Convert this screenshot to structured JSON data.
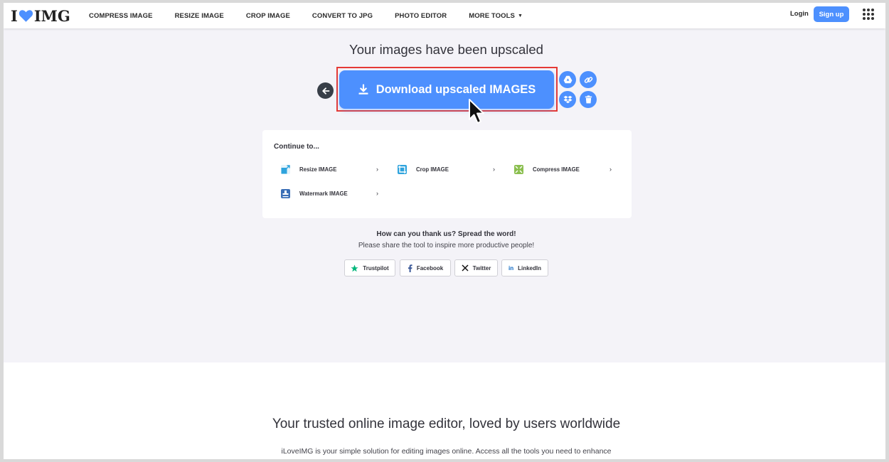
{
  "nav": {
    "logo_left": "I",
    "logo_right": "IMG",
    "links": [
      "COMPRESS IMAGE",
      "RESIZE IMAGE",
      "CROP IMAGE",
      "CONVERT TO JPG",
      "PHOTO EDITOR",
      "MORE TOOLS"
    ],
    "login": "Login",
    "signup": "Sign up"
  },
  "main": {
    "headline": "Your images have been upscaled",
    "download_label": "Download upscaled IMAGES"
  },
  "continue": {
    "title": "Continue to...",
    "tools": [
      {
        "label": "Resize IMAGE",
        "icon": "resize-icon"
      },
      {
        "label": "Crop IMAGE",
        "icon": "crop-icon"
      },
      {
        "label": "Compress IMAGE",
        "icon": "compress-icon"
      },
      {
        "label": "Watermark IMAGE",
        "icon": "watermark-icon"
      }
    ]
  },
  "share": {
    "title": "How can you thank us? Spread the word!",
    "subtitle": "Please share the tool to inspire more productive people!",
    "buttons": [
      "Trustpilot",
      "Facebook",
      "Twitter",
      "LinkedIn"
    ]
  },
  "footer": {
    "title": "Your trusted online image editor, loved by users worldwide",
    "text": "iLoveIMG is your simple solution for editing images online. Access all the tools you need to enhance"
  },
  "colors": {
    "accent": "#4d90fe",
    "highlight": "#e53935",
    "back_button": "#383e48"
  }
}
